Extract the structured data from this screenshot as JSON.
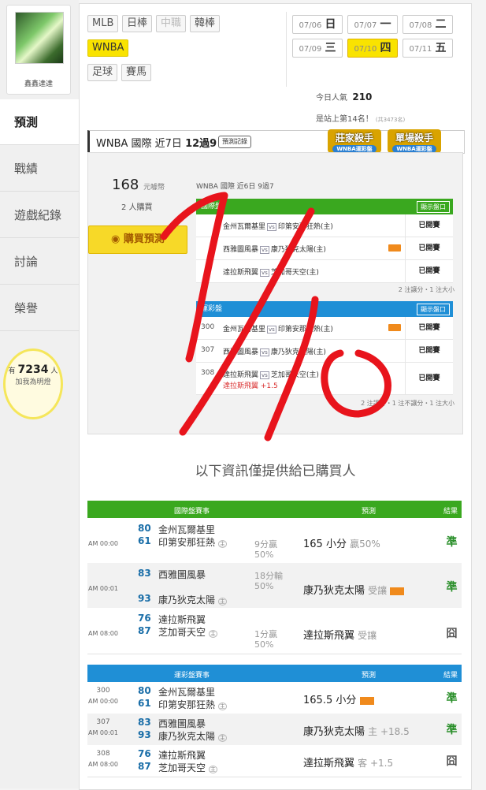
{
  "profile": {
    "name": "鑫鑫達達"
  },
  "nav": [
    "預測",
    "戰績",
    "遊戲紀錄",
    "討論",
    "榮譽"
  ],
  "fans": {
    "prefix": "有",
    "count": "7234",
    "suffix": "人",
    "label": "加我為明燈"
  },
  "league_tabs": [
    "MLB",
    "日棒",
    "中職",
    "韓棒",
    "WNBA",
    "足球",
    "賽馬"
  ],
  "dates": [
    {
      "d": "07/06",
      "w": "日"
    },
    {
      "d": "07/07",
      "w": "一"
    },
    {
      "d": "07/08",
      "w": "二"
    },
    {
      "d": "07/09",
      "w": "三"
    },
    {
      "d": "07/10",
      "w": "四"
    },
    {
      "d": "07/11",
      "w": "五"
    }
  ],
  "stats": {
    "pop_label": "今日人氣",
    "pop_value": "210",
    "rank_text": "是站上第14名！",
    "rank_small": "(共3473名)"
  },
  "header": {
    "title_a": "WNBA 國際 近7日 ",
    "title_b": "12過9",
    "record_btn": "預測記錄"
  },
  "badges": {
    "b1": "莊家殺手",
    "b2": "單場殺手",
    "sub": "WNBA運彩盤"
  },
  "preview": {
    "price": "168",
    "price_unit": "元噱幣",
    "buyers": "2 人購買",
    "buy_btn": "購買預測",
    "sub": "WNBA 國際 近6日 9過7",
    "intl_title": "國際盤",
    "show_btn": "顯示盤口",
    "intl_rows": [
      {
        "num": "",
        "home": "金州瓦爾基里",
        "vs": "vs",
        "away": "印第安那狂熱(主)",
        "st": "已開賽"
      },
      {
        "num": "",
        "home": "西雅圖風暴",
        "vs": "vs",
        "away": "康乃狄克太陽(主)",
        "st": "已開賽"
      },
      {
        "num": "",
        "home": "達拉斯飛翼",
        "vs": "vs",
        "away": "芝加哥天空(主)",
        "st": "已開賽"
      }
    ],
    "intl_note": "2 注讓分・1 注大小",
    "sport_title": "運彩盤",
    "sport_rows": [
      {
        "num": "300",
        "home": "金州瓦爾基里",
        "vs": "vs",
        "away": "印第安那狂熱(主)",
        "st": "已開賽",
        "sub": ""
      },
      {
        "num": "307",
        "home": "西雅圖風暴",
        "vs": "vs",
        "away": "康乃狄克太陽(主)",
        "st": "已開賽",
        "sub": ""
      },
      {
        "num": "308",
        "home": "達拉斯飛翼",
        "vs": "vs",
        "away": "芝加哥天空(主)",
        "st": "已開賽",
        "sub": "達拉斯飛翼 +1.5"
      }
    ],
    "sport_note": "2 注讓分・1 注不讓分・1 注大小"
  },
  "notice": "以下資訊僅提供給已購買人",
  "intl_table": {
    "head": {
      "match": "國際盤賽事",
      "pred": "預測",
      "res": "結果"
    },
    "rows": [
      {
        "time": "AM 00:00",
        "s1": "80",
        "t1": "金州瓦爾基里",
        "s2": "61",
        "t2": "印第安那狂熱",
        "n1": "9分贏",
        "n2": "50%",
        "pred": "165 小分",
        "pred2": "贏50%",
        "res": "準"
      },
      {
        "time": "AM 00:01",
        "s1": "83",
        "t1": "西雅圖風暴",
        "s2": "93",
        "t2": "康乃狄克太陽",
        "n1": "18分輸",
        "n2": "50%",
        "pred": "康乃狄克太陽",
        "pred2": "受讓",
        "res": "準"
      },
      {
        "time": "AM 08:00",
        "s1": "76",
        "t1": "達拉斯飛翼",
        "s2": "87",
        "t2": "芝加哥天空",
        "n1": "1分贏",
        "n2": "50%",
        "pred": "達拉斯飛翼",
        "pred2": "受讓",
        "res": "囧"
      }
    ]
  },
  "sport_table": {
    "head": {
      "match": "運彩盤賽事",
      "pred": "預測",
      "res": "結果"
    },
    "rows": [
      {
        "num": "300",
        "time": "AM 00:00",
        "s1": "80",
        "t1": "金州瓦爾基里",
        "s2": "61",
        "t2": "印第安那狂熱",
        "pred": "165.5 小分",
        "pred2": "",
        "res": "準"
      },
      {
        "num": "307",
        "time": "AM 00:01",
        "s1": "83",
        "t1": "西雅圖風暴",
        "s2": "93",
        "t2": "康乃狄克太陽",
        "pred": "康乃狄克太陽",
        "pred2": "主 +18.5",
        "res": "準"
      },
      {
        "num": "308",
        "time": "AM 08:00",
        "s1": "76",
        "t1": "達拉斯飛翼",
        "s2": "87",
        "t2": "芝加哥天空",
        "pred": "達拉斯飛翼",
        "pred2": "客 +1.5",
        "res": "囧"
      }
    ]
  },
  "home_mark": "主",
  "handwriting": "7/10",
  "colors": {
    "green": "#3aa81f",
    "blue": "#1f8fd6",
    "yellow": "#f9e300",
    "scribble": "#e8141c"
  }
}
